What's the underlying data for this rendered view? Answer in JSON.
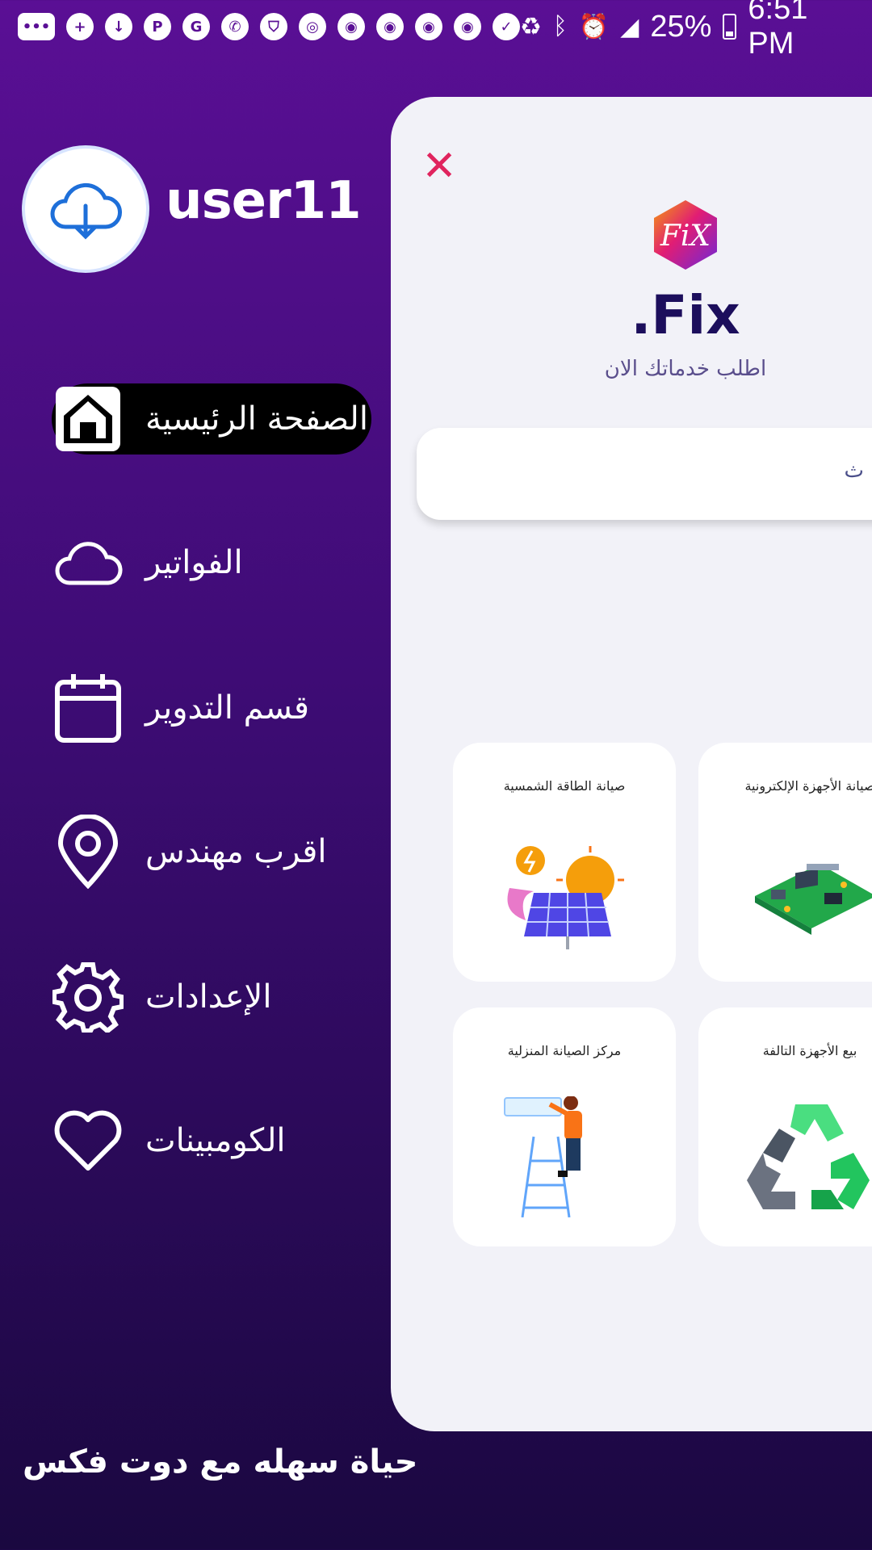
{
  "status_bar": {
    "battery": "25%",
    "time": "6:51 PM"
  },
  "drawer": {
    "username": "user11",
    "menu": [
      {
        "label": "الصفحة الرئيسية",
        "icon": "home-icon",
        "active": true
      },
      {
        "label": "الفواتير",
        "icon": "cloud-icon"
      },
      {
        "label": "قسم التدوير",
        "icon": "calendar-icon"
      },
      {
        "label": "اقرب مهندس",
        "icon": "location-pin-icon"
      },
      {
        "label": "الإعدادات",
        "icon": "gear-icon"
      },
      {
        "label": "الكومبينات",
        "icon": "heart-icon"
      }
    ],
    "tagline": "حياة سهله مع دوت فكس"
  },
  "main": {
    "brand": ".Fix",
    "subtitle": "اطلب خدماتك الان",
    "search_placeholder": "ث",
    "cards": [
      {
        "title": "صيانة الطاقة الشمسية",
        "icon": "solar-panel-icon"
      },
      {
        "title": "صيانة الأجهزة الإلكترونية",
        "icon": "circuit-board-icon"
      },
      {
        "title": "مركز الصيانة المنزلية",
        "icon": "ac-technician-icon"
      },
      {
        "title": "بيع الأجهزة التالفة",
        "icon": "recycle-icon"
      }
    ]
  },
  "colors": {
    "accent": "#e0245e",
    "brand_text": "#1c0e5c",
    "bg_top": "#5a0f95",
    "bg_bottom": "#1a0840"
  }
}
